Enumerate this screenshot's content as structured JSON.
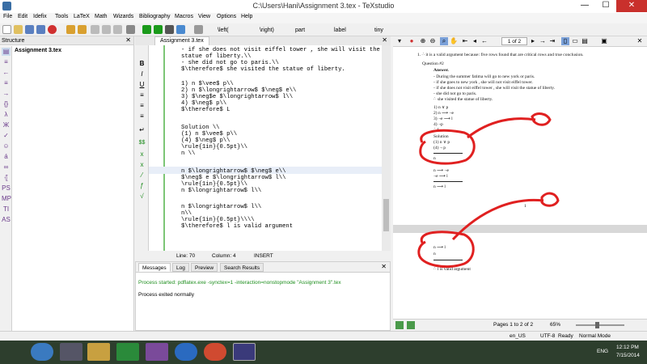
{
  "window": {
    "title": "C:\\Users\\Hani\\Assignment 3.tex - TeXstudio",
    "minimize": "—",
    "maximize": "☐",
    "close": "✕"
  },
  "menu": [
    "File",
    "Edit",
    "Idefix",
    "Tools",
    "LaTeX",
    "Math",
    "Wizards",
    "Bibliography",
    "Macros",
    "View",
    "Options",
    "Help"
  ],
  "toolbar": {
    "left_combo": "\\left(",
    "right_combo": "\\right)",
    "part_combo": "part",
    "label_combo": "label",
    "size_combo": "tiny"
  },
  "structure": {
    "header": "Structure",
    "close": "✕",
    "doc": "Assignment 3.tex"
  },
  "editor": {
    "tab": "Assignment 3.tex",
    "close": "✕",
    "lines": [
      "- if she does not visit eiffel tower , she will visit the",
      "statue of liberty.\\\\",
      "- she did not go to paris.\\\\",
      "$\\therefore$ she visited the statue of liberty.",
      "",
      "1) n $\\vee$ p\\\\",
      "2) n $\\longrightarrow$ $\\neg$ e\\\\",
      "3) $\\neg$e $\\longrightarrow$ l\\\\",
      "4) $\\neg$ p\\\\",
      "$\\therefore$ L",
      "",
      "Solution \\\\",
      "(1) n $\\vee$ p\\\\",
      "(4) $\\neg$ p\\\\",
      "\\rule{1in}{0.5pt}\\\\",
      "n \\\\",
      "",
      "n $\\longrightarrow$ $\\neg$ e\\\\",
      "$\\neg$ e $\\longrightarrow$ l\\\\",
      "\\rule{1in}{0.5pt}\\\\",
      "n $\\longrightarrow$ l\\\\",
      "",
      "n $\\longrightarrow$ l\\\\",
      "n\\\\",
      "\\rule{1in}{0.5pt}\\\\\\\\",
      "$\\therefore$ l is valid argument"
    ],
    "status_line": "Line: 70",
    "status_column": "Column: 4",
    "status_mode": "INSERT"
  },
  "messages": {
    "tabs": [
      "Messages",
      "Log",
      "Preview",
      "Search Results"
    ],
    "close": "✕",
    "process_started": "Process started: pdflatex.exe -synctex=1 -interaction=nonstopmode \"Assignment 3\".tex",
    "process_exited": "Process exited normally"
  },
  "pdf": {
    "page_field": "1 of 2",
    "page1": {
      "top_line": "1.   ∴ it is a valid argument because: five rows found that are critical rows and true conclusion.",
      "question_num": "1.",
      "question_title": "Question #2",
      "answer": "Answer.",
      "premises": [
        "- During the summer fatima will go to new york or paris.",
        "- if she goes to new york , she will not visit eiffel tower.",
        "- if she does not visit eiffel tower , she will visit the statue of liberty.",
        "- she did not go to paris.",
        "∴ she visited the statue of liberty."
      ],
      "numbered": [
        "1) n ∨ p",
        "2) n ⟶ ¬e",
        "3) ¬e ⟶ l",
        "4) ¬p",
        "∴ L"
      ],
      "solution": [
        "Solution",
        "(1) n ∨ p",
        "(4) ¬ p"
      ],
      "after_rule1": "n",
      "block2": [
        "n ⟶ ¬e",
        "¬e ⟶ l"
      ],
      "after_rule2": "n ⟶ l",
      "page_number": "1"
    },
    "page2": {
      "lines": [
        "n ⟶ l",
        "n"
      ],
      "conclusion": "∴ l is valid argument"
    },
    "pages_label": "Pages 1 to 2 of 2",
    "zoom": "65%"
  },
  "statusbar": {
    "lang": "en_US",
    "encoding": "UTF-8",
    "ready": "Ready",
    "mode": "Normal Mode"
  },
  "taskbar": {
    "lang": "ENG",
    "time": "12:12 PM",
    "date": "7/15/2014"
  },
  "colors": {
    "annotation_red": "#e02020",
    "code_green": "#7cc576",
    "close_red": "#c9302c"
  }
}
